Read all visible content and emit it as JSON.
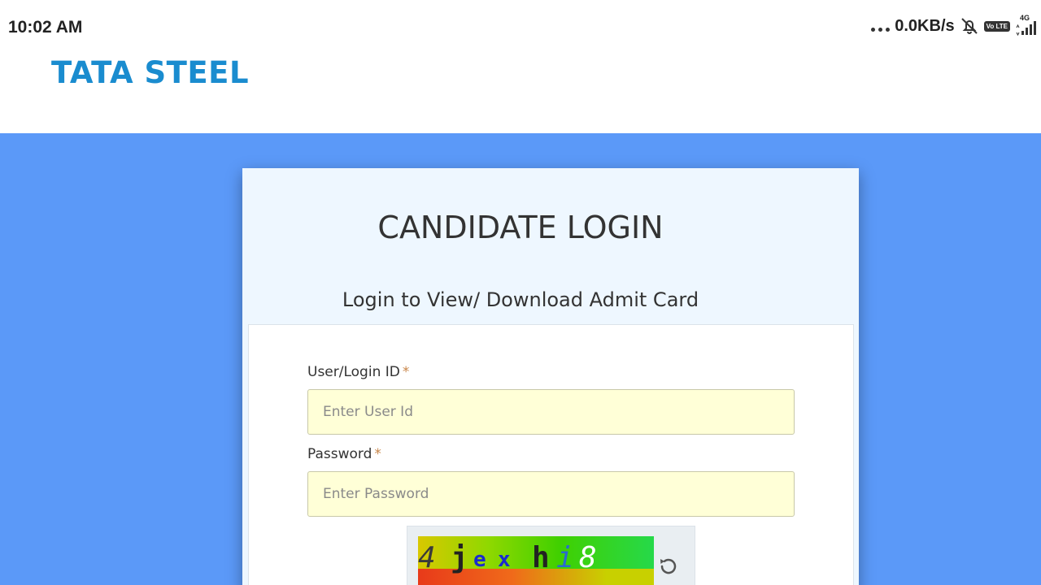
{
  "status_bar": {
    "time": "10:02 AM",
    "net_speed": "0.0KB/s",
    "volte": "Vo LTE",
    "network_type": "4G",
    "icons": [
      "more-dots-icon",
      "bell-muted-icon",
      "volte-icon",
      "signal-icon"
    ]
  },
  "header": {
    "logo_text": "TATA STEEL",
    "brand_color": "#1a8ccf"
  },
  "login": {
    "title": "CANDIDATE LOGIN",
    "subtitle": "Login to View/ Download Admit Card",
    "user_id_label": "User/Login ID",
    "user_id_placeholder": "Enter User Id",
    "user_id_value": "",
    "password_label": "Password",
    "password_placeholder": "Enter Password",
    "password_value": "",
    "required_marker": "*",
    "captcha": {
      "characters": [
        "4",
        "j",
        "e",
        "x",
        "h",
        "i",
        "8"
      ],
      "char_colors": [
        "#3a3a3a",
        "#222222",
        "#1a2ad0",
        "#1a2ad0",
        "#222222",
        "#2a6ad0",
        "#ffffff"
      ],
      "refresh_icon": "refresh-icon"
    }
  },
  "colors": {
    "background_blue": "#5b99f8",
    "card_bg": "#eef7ff",
    "input_bg": "#ffffd7",
    "required_color": "#c8864a"
  }
}
